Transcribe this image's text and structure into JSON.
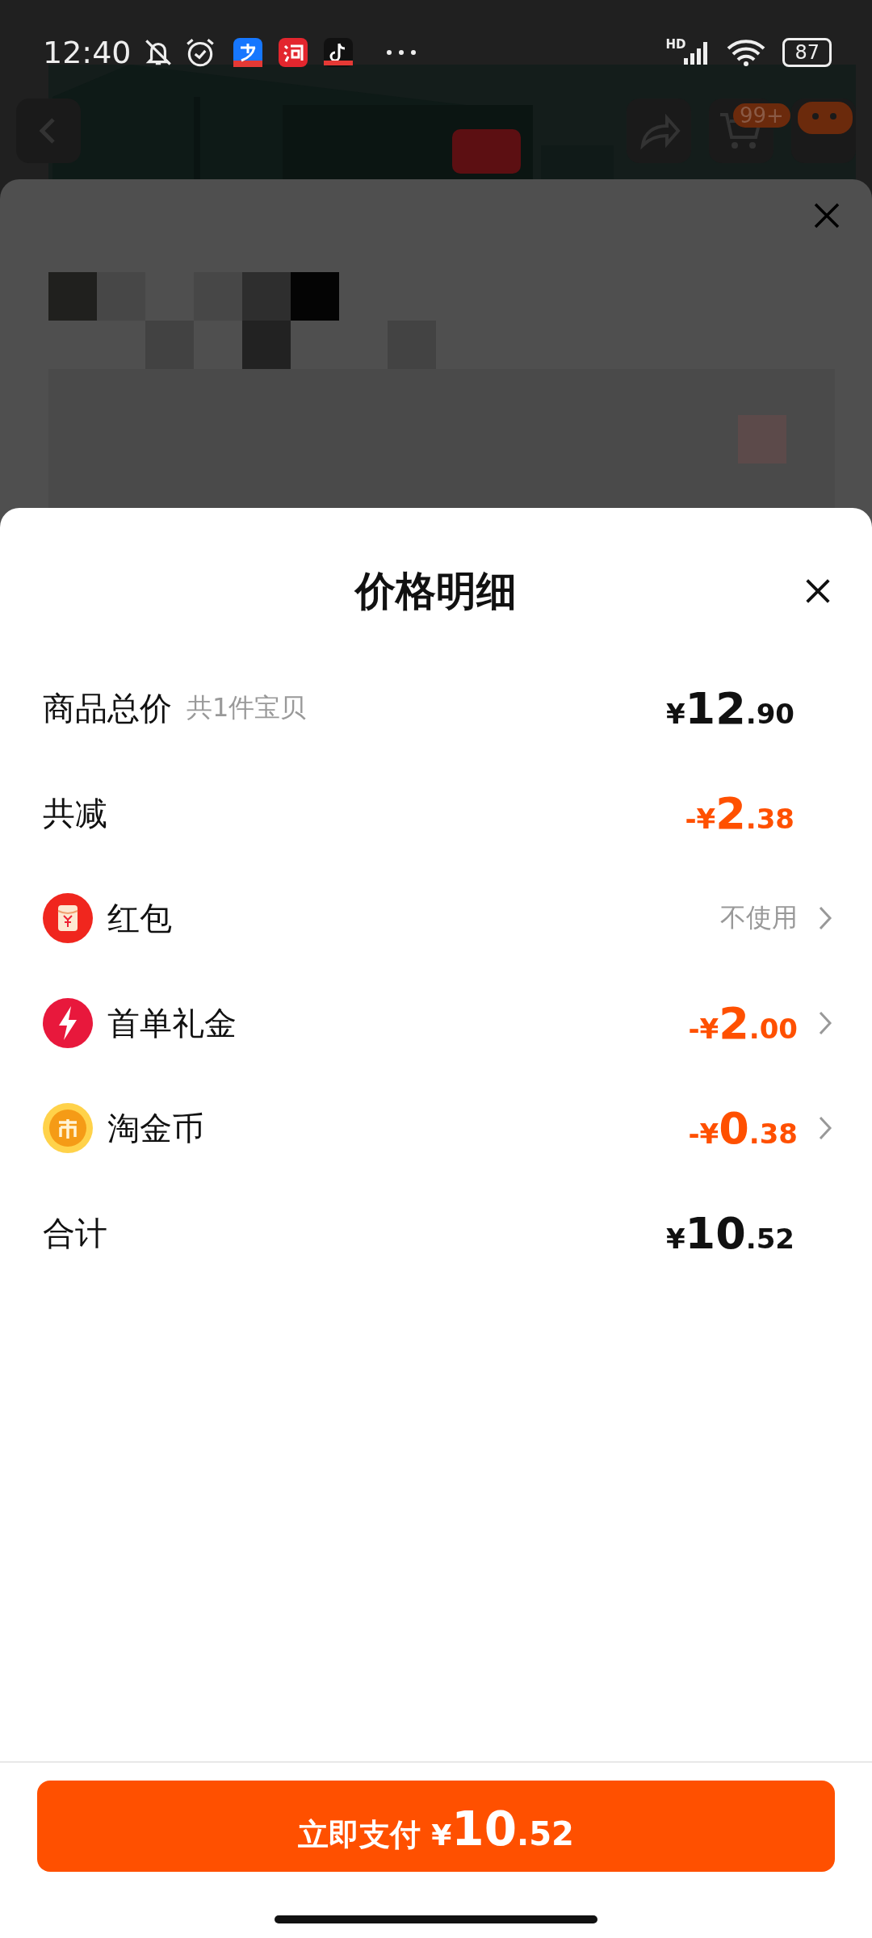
{
  "status_bar": {
    "time": "12:40",
    "network": "HD",
    "battery": "87"
  },
  "background_page": {
    "cart_badge": "99+"
  },
  "price_sheet": {
    "title": "价格明细",
    "rows": [
      {
        "kind": "plain",
        "label": "商品总价",
        "note": "共1件宝贝",
        "amount": {
          "sign": "¥",
          "integer": "12",
          "decimal": ".90",
          "negative": false
        }
      },
      {
        "kind": "plain",
        "label": "共减",
        "amount": {
          "sign": "-¥",
          "integer": "2",
          "decimal": ".38",
          "negative": true
        }
      },
      {
        "kind": "option",
        "label": "红包",
        "value": "不使用"
      },
      {
        "kind": "option",
        "label": "首单礼金",
        "amount": {
          "sign": "-¥",
          "integer": "2",
          "decimal": ".00",
          "negative": true
        }
      },
      {
        "kind": "option",
        "label": "淘金币",
        "amount": {
          "sign": "-¥",
          "integer": "0",
          "decimal": ".38",
          "negative": true
        }
      },
      {
        "kind": "plain",
        "label": "合计",
        "amount": {
          "sign": "¥",
          "integer": "10",
          "decimal": ".52",
          "negative": false
        }
      }
    ],
    "pay_button": {
      "label": "立即支付",
      "amount": {
        "sign": "¥",
        "integer": "10",
        "decimal": ".52"
      }
    }
  }
}
